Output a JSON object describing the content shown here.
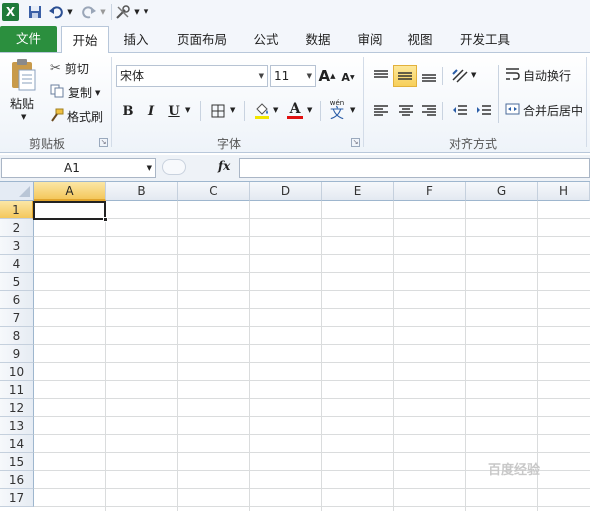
{
  "qat": {
    "app_icon": "X",
    "save_icon": "floppy-disk-icon",
    "undo_icon": "undo-icon",
    "redo_icon": "redo-icon",
    "tools_icon": "tools-icon",
    "customize_icon": "customize-menu-icon"
  },
  "tabs": [
    "文件",
    "开始",
    "插入",
    "页面布局",
    "公式",
    "数据",
    "审阅",
    "视图",
    "开发工具"
  ],
  "ribbon": {
    "clipboard": {
      "paste": "粘贴",
      "cut": "剪切",
      "copy": "复制",
      "format_painter": "格式刷",
      "group_label": "剪贴板"
    },
    "font": {
      "font_name": "宋体",
      "font_size": "11",
      "grow": "A",
      "shrink": "A",
      "bold": "B",
      "italic": "I",
      "underline": "U",
      "text_color_letter": "A",
      "phonetic": "wén",
      "phonetic_char": "文",
      "group_label": "字体"
    },
    "alignment": {
      "wrap_text": "自动换行",
      "merge_center": "合并后居中",
      "group_label": "对齐方式"
    }
  },
  "formula_bar": {
    "name_box": "A1",
    "fx": "fx",
    "value": ""
  },
  "grid": {
    "columns": [
      "A",
      "B",
      "C",
      "D",
      "E",
      "F",
      "G",
      "H"
    ],
    "rows": [
      "1",
      "2",
      "3",
      "4",
      "5",
      "6",
      "7",
      "8",
      "9",
      "10",
      "11",
      "12",
      "13",
      "14",
      "15",
      "16",
      "17"
    ],
    "active_cell": "A1"
  },
  "watermark": "百度经验",
  "colors": {
    "file_tab": "#2b8f3e",
    "selection_header": "#f4c75c",
    "grid_line": "#dadcdd",
    "underline_red": "#e01010"
  }
}
